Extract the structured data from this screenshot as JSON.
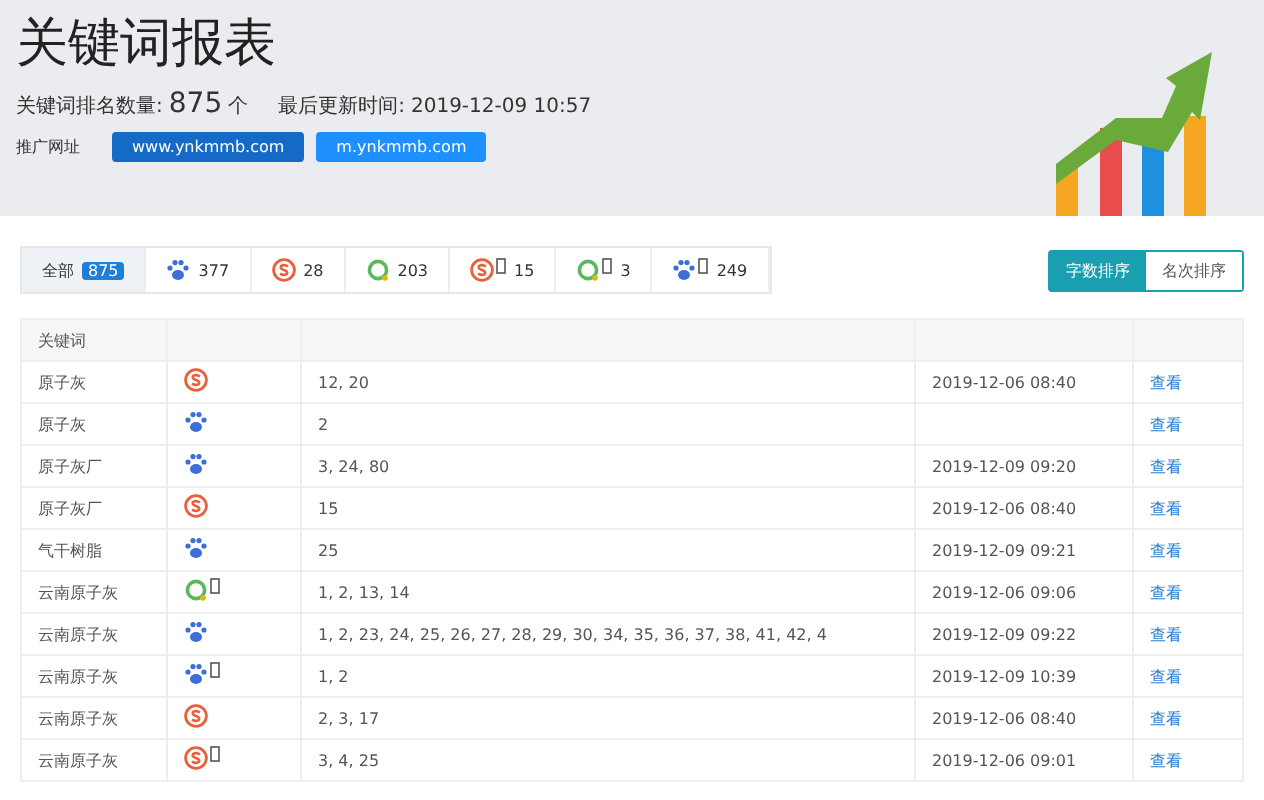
{
  "header": {
    "title": "关键词报表",
    "count_label": "关键词排名数量:",
    "count": "875",
    "count_unit": "个",
    "updated_label": "最后更新时间:",
    "updated": "2019-12-09 10:57",
    "links_label": "推广网址",
    "links": [
      "www.ynkmmb.com",
      "m.ynkmmb.com"
    ]
  },
  "filters": [
    {
      "kind": "all",
      "label": "全部",
      "count": "875",
      "selected": true
    },
    {
      "kind": "paw",
      "count": "377",
      "selected": false,
      "mobile": false
    },
    {
      "kind": "s",
      "count": "28",
      "selected": false,
      "mobile": false
    },
    {
      "kind": "ring",
      "count": "203",
      "selected": false,
      "mobile": false
    },
    {
      "kind": "s",
      "count": "15",
      "selected": false,
      "mobile": true
    },
    {
      "kind": "ring",
      "count": "3",
      "selected": false,
      "mobile": true
    },
    {
      "kind": "paw",
      "count": "249",
      "selected": false,
      "mobile": true
    }
  ],
  "sort_buttons": [
    {
      "label": "字数排序",
      "selected": true
    },
    {
      "label": "名次排序",
      "selected": false
    }
  ],
  "table": {
    "columns": [
      "关键词"
    ],
    "rows": [
      {
        "keyword": "原子灰",
        "kind": "s",
        "mobile": false,
        "ranks": "12, 20",
        "time": "2019-12-06 08:40",
        "action": "查看"
      },
      {
        "keyword": "原子灰",
        "kind": "paw",
        "mobile": false,
        "ranks": "2",
        "action": "查看"
      },
      {
        "keyword": "原子灰厂",
        "kind": "paw",
        "mobile": false,
        "ranks": "3, 24, 80",
        "time": "2019-12-09 09:20",
        "action": "查看"
      },
      {
        "keyword": "原子灰厂",
        "kind": "s",
        "mobile": false,
        "ranks": "15",
        "time": "2019-12-06 08:40",
        "action": "查看"
      },
      {
        "keyword": "气干树脂",
        "kind": "paw",
        "mobile": false,
        "ranks": "25",
        "time": "2019-12-09 09:21",
        "action": "查看"
      },
      {
        "keyword": "云南原子灰",
        "kind": "ring",
        "mobile": true,
        "ranks": "1, 2, 13, 14",
        "time": "2019-12-06 09:06",
        "action": "查看"
      },
      {
        "keyword": "云南原子灰",
        "kind": "paw",
        "mobile": false,
        "ranks": "1, 2, 23, 24, 25, 26, 27, 28, 29, 30, 34, 35, 36, 37, 38, 41, 42, 4",
        "time": "2019-12-09 09:22",
        "action": "查看"
      },
      {
        "keyword": "云南原子灰",
        "kind": "paw",
        "mobile": true,
        "ranks": "1, 2",
        "time": "2019-12-09 10:39",
        "action": "查看"
      },
      {
        "keyword": "云南原子灰",
        "kind": "s",
        "mobile": false,
        "ranks": "2, 3, 17",
        "time": "2019-12-06 08:40",
        "action": "查看"
      },
      {
        "keyword": "云南原子灰",
        "kind": "s",
        "mobile": true,
        "ranks": "3, 4, 25",
        "time": "2019-12-06 09:01",
        "action": "查看"
      }
    ]
  }
}
